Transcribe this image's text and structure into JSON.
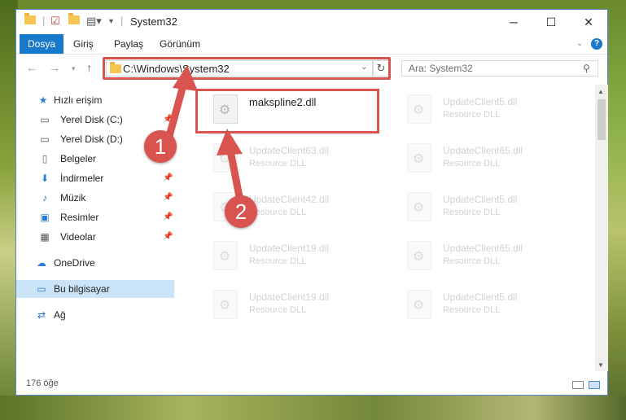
{
  "window": {
    "title": "System32",
    "minimize_icon": "minimize-icon",
    "maximize_icon": "maximize-icon",
    "close_icon": "close-icon"
  },
  "ribbon": {
    "tabs": [
      "Dosya",
      "Giriş",
      "Paylaş",
      "Görünüm"
    ]
  },
  "address": {
    "path": "C:\\Windows\\System32",
    "search_placeholder": "Ara: System32"
  },
  "sidebar": {
    "items": [
      {
        "label": "Hızlı erişim",
        "icon": "star-icon"
      },
      {
        "label": "Yerel Disk (C:)",
        "icon": "drive-icon"
      },
      {
        "label": "Yerel Disk (D:)",
        "icon": "drive-icon"
      },
      {
        "label": "Belgeler",
        "icon": "documents-icon"
      },
      {
        "label": "İndirmeler",
        "icon": "download-icon"
      },
      {
        "label": "Müzik",
        "icon": "music-icon"
      },
      {
        "label": "Resimler",
        "icon": "pictures-icon"
      },
      {
        "label": "Videolar",
        "icon": "video-icon"
      },
      {
        "label": "OneDrive",
        "icon": "cloud-icon"
      },
      {
        "label": "Bu bilgisayar",
        "icon": "computer-icon"
      },
      {
        "label": "Ağ",
        "icon": "network-icon"
      }
    ]
  },
  "files": [
    {
      "name": "makspline2.dll",
      "type": ""
    },
    {
      "name": "UpdateClient5.dll",
      "type": "Resource DLL"
    },
    {
      "name": "UpdateClient63.dll",
      "type": "Resource DLL"
    },
    {
      "name": "UpdateClient65.dll",
      "type": "Resource DLL"
    },
    {
      "name": "UpdateClient42.dll",
      "type": "Resource DLL"
    },
    {
      "name": "UpdateClient5.dll",
      "type": "Resource DLL"
    },
    {
      "name": "UpdateClient19.dll",
      "type": "Resource DLL"
    },
    {
      "name": "UpdateClient65.dll",
      "type": "Resource DLL"
    },
    {
      "name": "UpdateClient19.dll",
      "type": "Resource DLL"
    },
    {
      "name": "UpdateClient5.dll",
      "type": "Resource DLL"
    }
  ],
  "status": {
    "count": "176 öğe"
  },
  "annotations": {
    "step1": "1",
    "step2": "2",
    "color": "#d9534f"
  }
}
